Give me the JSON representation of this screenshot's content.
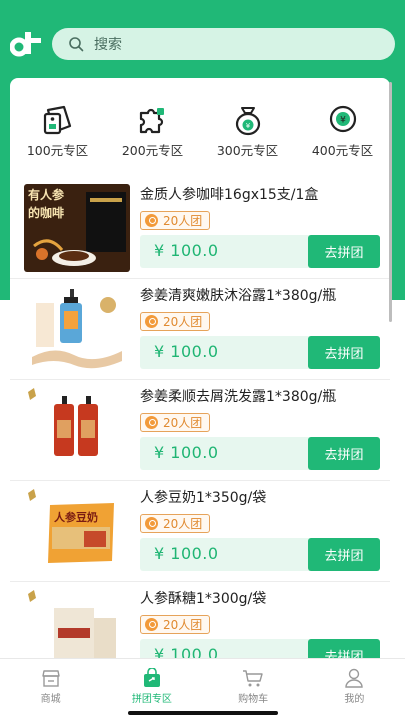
{
  "search": {
    "placeholder": "搜索",
    "icon": "search-icon"
  },
  "zones": [
    {
      "label": "100元专区",
      "icon": "tag-icon"
    },
    {
      "label": "200元专区",
      "icon": "puzzle-icon"
    },
    {
      "label": "300元专区",
      "icon": "money-bag-icon"
    },
    {
      "label": "400元专区",
      "icon": "yuan-coin-icon"
    }
  ],
  "products": [
    {
      "title": "金质人参咖啡16gx15支/1盒",
      "badge": "20人团",
      "price": "¥ 100.0",
      "button": "去拼团",
      "thumb_text": [
        "有人参",
        "的咖啡"
      ]
    },
    {
      "title": "参姜清爽嫩肤沐浴露1*380g/瓶",
      "badge": "20人团",
      "price": "¥ 100.0",
      "button": "去拼团"
    },
    {
      "title": "参姜柔顺去屑洗发露1*380g/瓶",
      "badge": "20人团",
      "price": "¥ 100.0",
      "button": "去拼团"
    },
    {
      "title": "人参豆奶1*350g/袋",
      "badge": "20人团",
      "price": "¥ 100.0",
      "button": "去拼团",
      "thumb_text": [
        "人参豆奶"
      ]
    },
    {
      "title": "人参酥糖1*300g/袋",
      "badge": "20人团",
      "price": "¥ 100.0",
      "button": "去拼团"
    }
  ],
  "tabbar": [
    {
      "label": "商城",
      "icon": "store-icon",
      "active": false
    },
    {
      "label": "拼团专区",
      "icon": "group-buy-bag-icon",
      "active": true
    },
    {
      "label": "购物车",
      "icon": "cart-icon",
      "active": false
    },
    {
      "label": "我的",
      "icon": "user-icon",
      "active": false
    }
  ],
  "colors": {
    "brand": "#20b877",
    "price": "#1fb573",
    "badge": "#e08a30"
  }
}
